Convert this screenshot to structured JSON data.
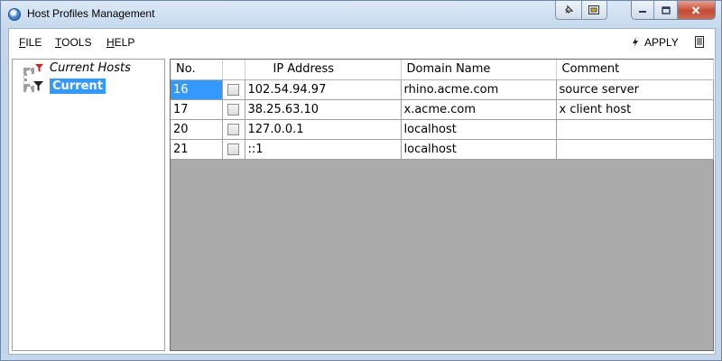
{
  "window": {
    "title": "Host Profiles Management"
  },
  "menu": {
    "file": {
      "accel": "F",
      "rest": "ILE"
    },
    "tools": {
      "accel": "T",
      "rest": "OOLS"
    },
    "help": {
      "accel": "H",
      "rest": "ELP"
    },
    "apply": {
      "accel": "A",
      "rest": "PPLY"
    }
  },
  "tree": {
    "nodes": [
      {
        "label": "Current Hosts",
        "icon": "red-funnel-icon"
      },
      {
        "label": "Current",
        "icon": "black-funnel-icon",
        "selected": true
      }
    ]
  },
  "grid": {
    "columns": [
      "No.",
      "",
      "IP Address",
      "Domain Name",
      "Comment"
    ],
    "rows": [
      {
        "no": "16",
        "checked": false,
        "ip": "102.54.94.97",
        "domain": "rhino.acme.com",
        "comment": "source server",
        "selected": true
      },
      {
        "no": "17",
        "checked": false,
        "ip": "38.25.63.10",
        "domain": "x.acme.com",
        "comment": "x client host"
      },
      {
        "no": "20",
        "checked": false,
        "ip": "127.0.0.1",
        "domain": "localhost",
        "comment": ""
      },
      {
        "no": "21",
        "checked": false,
        "ip": "::1",
        "domain": "localhost",
        "comment": ""
      }
    ]
  },
  "colors": {
    "selection": "#3399ff",
    "grid_empty": "#ababab",
    "frame": "#c3d6ea"
  }
}
